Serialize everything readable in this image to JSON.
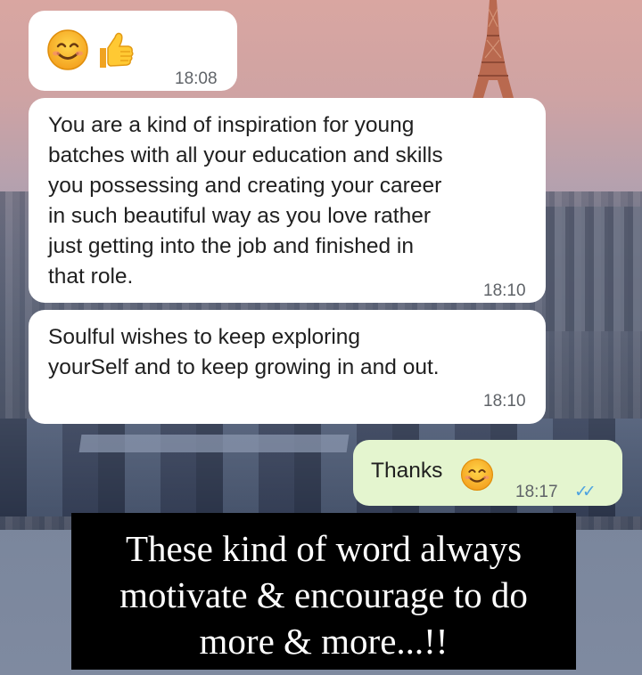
{
  "messages": [
    {
      "direction": "incoming",
      "emoji": [
        "smiling-face-icon",
        "thumbs-up-icon"
      ],
      "time": "18:08"
    },
    {
      "direction": "incoming",
      "text": "You are a kind of inspiration for young\nbatches with all your education and skills\nyou possessing and creating your career\nin such beautiful way as you love rather\njust getting into the job and finished in\nthat role.",
      "time": "18:10"
    },
    {
      "direction": "incoming",
      "text": "Soulful wishes to keep exploring\nyourSelf and to keep growing in and out.",
      "time": "18:10"
    },
    {
      "direction": "outgoing",
      "text": "Thanks",
      "emoji": [
        "smiling-face-icon"
      ],
      "time": "18:17",
      "status": "read-double-check-icon"
    }
  ],
  "caption": {
    "lines": [
      "These kind of word always",
      "motivate & encourage to do",
      "more & more...!!"
    ]
  },
  "colors": {
    "incoming_bubble": "#ffffff",
    "outgoing_bubble": "#e4f5cf",
    "read_ticks": "#4fa3e0",
    "caption_bg": "#000000"
  }
}
